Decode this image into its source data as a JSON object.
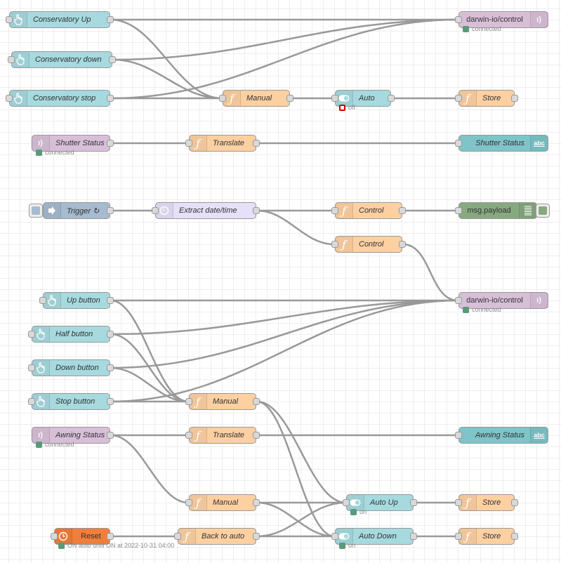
{
  "colors": {
    "ui_inject": "#a6dadf",
    "mqtt": "#d8bfd8",
    "function": "#fdd0a2",
    "switch": "#a6dadf",
    "text_output": "#7ec4c8",
    "trigger": "#a6bbcf",
    "date_time": "#e6e0f8",
    "debug": "#87a980",
    "scheduler": "#f07f3b",
    "wire": "#999999",
    "status_green": "#5a9a7a",
    "status_red": "#cc0000"
  },
  "nodes": [
    {
      "id": "n1",
      "label": "Conservatory Up",
      "type": "ui_inject",
      "icon": "hand-pointer-icon"
    },
    {
      "id": "n2",
      "label": "Conservatory down",
      "type": "ui_inject",
      "icon": "hand-pointer-icon"
    },
    {
      "id": "n3",
      "label": "Conservatory stop",
      "type": "ui_inject",
      "icon": "hand-pointer-icon"
    },
    {
      "id": "n4",
      "label": "darwin-io/control",
      "type": "mqtt_out",
      "icon": "mqtt-wave-icon",
      "status": {
        "color": "green",
        "text": "connected"
      }
    },
    {
      "id": "n5",
      "label": "Manual",
      "type": "function",
      "icon": "function-icon"
    },
    {
      "id": "n6",
      "label": "Auto",
      "type": "switch",
      "icon": "toggle-icon",
      "status": {
        "color": "red-ring",
        "text": "off"
      }
    },
    {
      "id": "n7",
      "label": "Store",
      "type": "function",
      "icon": "function-icon"
    },
    {
      "id": "n8",
      "label": "Shutter Status",
      "type": "mqtt_in",
      "icon": "mqtt-wave-icon",
      "status": {
        "color": "green",
        "text": "connected"
      }
    },
    {
      "id": "n9",
      "label": "Translate",
      "type": "function",
      "icon": "function-icon"
    },
    {
      "id": "n10",
      "label": "Shutter Status",
      "type": "text_output",
      "icon": "abc-icon"
    },
    {
      "id": "n11",
      "label": "Trigger ↻",
      "type": "trigger",
      "icon": "arrow-right-icon"
    },
    {
      "id": "n12",
      "label": "Extract date/time",
      "type": "date_time",
      "icon": "timer-icon"
    },
    {
      "id": "n13",
      "label": "Control",
      "type": "function",
      "icon": "function-icon"
    },
    {
      "id": "n14",
      "label": "msg.payload",
      "type": "debug",
      "icon": "list-icon"
    },
    {
      "id": "n15",
      "label": "Control",
      "type": "function",
      "icon": "function-icon"
    },
    {
      "id": "n16",
      "label": "darwin-io/control",
      "type": "mqtt_out",
      "icon": "mqtt-wave-icon",
      "status": {
        "color": "green",
        "text": "connected"
      }
    },
    {
      "id": "n17",
      "label": "Up button",
      "type": "ui_inject",
      "icon": "hand-pointer-icon"
    },
    {
      "id": "n18",
      "label": "Half button",
      "type": "ui_inject",
      "icon": "hand-pointer-icon"
    },
    {
      "id": "n19",
      "label": "Down button",
      "type": "ui_inject",
      "icon": "hand-pointer-icon"
    },
    {
      "id": "n20",
      "label": "Stop button",
      "type": "ui_inject",
      "icon": "hand-pointer-icon"
    },
    {
      "id": "n21",
      "label": "Manual",
      "type": "function",
      "icon": "function-icon"
    },
    {
      "id": "n22",
      "label": "Awning Status",
      "type": "mqtt_in",
      "icon": "mqtt-wave-icon",
      "status": {
        "color": "green",
        "text": "connected"
      }
    },
    {
      "id": "n23",
      "label": "Translate",
      "type": "function",
      "icon": "function-icon"
    },
    {
      "id": "n24",
      "label": "Awning Status",
      "type": "text_output",
      "icon": "abc-icon"
    },
    {
      "id": "n25",
      "label": "Manual",
      "type": "function",
      "icon": "function-icon"
    },
    {
      "id": "n26",
      "label": "Auto Up",
      "type": "switch",
      "icon": "toggle-icon",
      "status": {
        "color": "green",
        "text": "on"
      }
    },
    {
      "id": "n27",
      "label": "Store",
      "type": "function",
      "icon": "function-icon"
    },
    {
      "id": "n28",
      "label": "Reset",
      "type": "scheduler",
      "icon": "clock-icon",
      "status": {
        "color": "green",
        "text": "ON auto until ON at 2022-10-31 04:00"
      }
    },
    {
      "id": "n29",
      "label": "Back to auto",
      "type": "function",
      "icon": "function-icon"
    },
    {
      "id": "n30",
      "label": "Auto Down",
      "type": "switch",
      "icon": "toggle-icon",
      "status": {
        "color": "green",
        "text": "on"
      }
    },
    {
      "id": "n31",
      "label": "Store",
      "type": "function",
      "icon": "function-icon"
    }
  ],
  "wires": [
    [
      "n1",
      "n4"
    ],
    [
      "n1",
      "n5"
    ],
    [
      "n2",
      "n4"
    ],
    [
      "n2",
      "n5"
    ],
    [
      "n3",
      "n4"
    ],
    [
      "n3",
      "n5"
    ],
    [
      "n5",
      "n6"
    ],
    [
      "n6",
      "n7"
    ],
    [
      "n8",
      "n9"
    ],
    [
      "n9",
      "n10"
    ],
    [
      "n11",
      "n12"
    ],
    [
      "n12",
      "n13"
    ],
    [
      "n12",
      "n15"
    ],
    [
      "n13",
      "n14"
    ],
    [
      "n15",
      "n16"
    ],
    [
      "n17",
      "n16"
    ],
    [
      "n17",
      "n21"
    ],
    [
      "n18",
      "n16"
    ],
    [
      "n18",
      "n21"
    ],
    [
      "n19",
      "n16"
    ],
    [
      "n19",
      "n21"
    ],
    [
      "n20",
      "n16"
    ],
    [
      "n20",
      "n21"
    ],
    [
      "n21",
      "n26"
    ],
    [
      "n21",
      "n30"
    ],
    [
      "n22",
      "n23"
    ],
    [
      "n22",
      "n25"
    ],
    [
      "n23",
      "n24"
    ],
    [
      "n25",
      "n26"
    ],
    [
      "n25",
      "n30"
    ],
    [
      "n26",
      "n27"
    ],
    [
      "n28",
      "n29"
    ],
    [
      "n29",
      "n26"
    ],
    [
      "n29",
      "n30"
    ],
    [
      "n30",
      "n31"
    ]
  ]
}
